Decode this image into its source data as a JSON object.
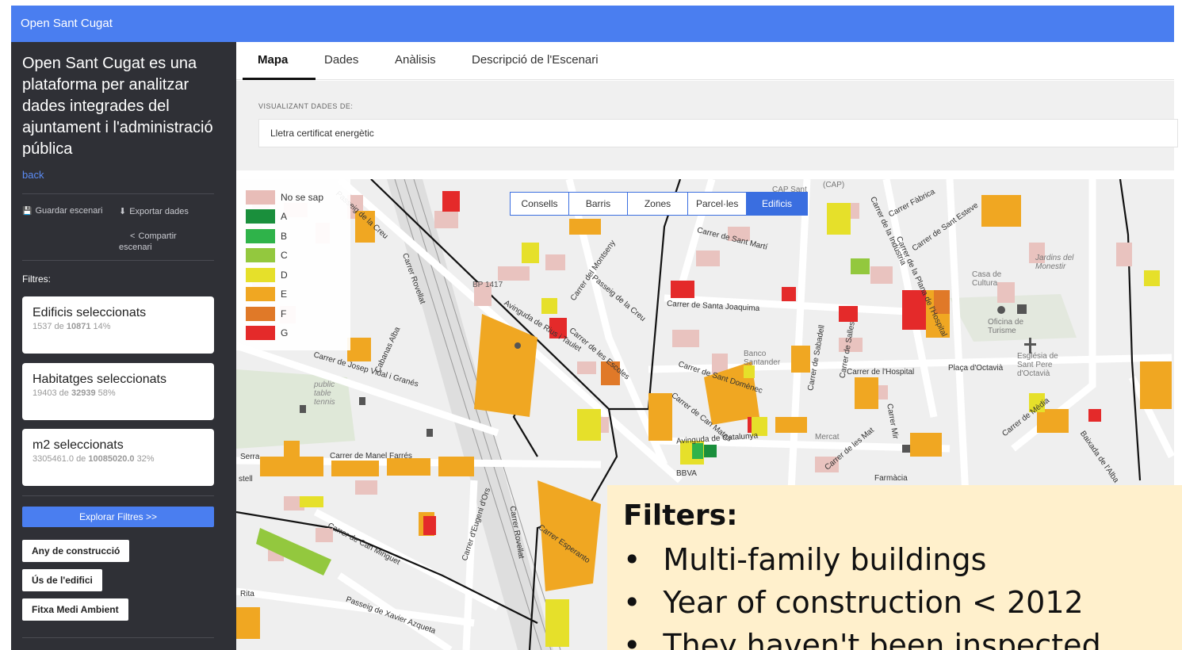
{
  "app_title": "Open Sant Cugat",
  "sidebar": {
    "description": "Open Sant Cugat es una plataforma per analitzar dades integrades del ajuntament i l'administració pública",
    "back": "back",
    "save_label": "Guardar escenari",
    "export_label": "Exportar dades",
    "share_label_1": "Compartir",
    "share_label_2": "escenari",
    "filters_heading": "Filtres:",
    "cards": [
      {
        "title": "Edificis seleccionats",
        "selected": "1537",
        "de": "de",
        "total": "10871",
        "pct": "14%"
      },
      {
        "title": "Habitatges seleccionats",
        "selected": "19403",
        "de": "de",
        "total": "32939",
        "pct": "58%"
      },
      {
        "title": "m2 seleccionats",
        "selected": "3305461.0",
        "de": "de",
        "total": "10085020.0",
        "pct": "32%"
      }
    ],
    "explore_button": "Explorar Filtres >>",
    "chips": [
      "Any de construcció",
      "Ús de l'edifici",
      "Fitxa Medi Ambient"
    ]
  },
  "tabs": [
    "Mapa",
    "Dades",
    "Anàlisis",
    "Descripció de l'Escenari"
  ],
  "active_tab": "Mapa",
  "viz_label": "VISUALIZANT DADES DE:",
  "viz_value": "Lletra certificat energètic",
  "layer_tabs": [
    "Consells",
    "Barris",
    "Zones",
    "Parcel·les",
    "Edificis"
  ],
  "active_layer": "Edificis",
  "legend": [
    {
      "label": "No se sap",
      "color": "#e8bdb8"
    },
    {
      "label": "A",
      "color": "#1a8f3c"
    },
    {
      "label": "B",
      "color": "#2fb34a"
    },
    {
      "label": "C",
      "color": "#93c83e"
    },
    {
      "label": "D",
      "color": "#e6e02a"
    },
    {
      "label": "E",
      "color": "#f0a722"
    },
    {
      "label": "F",
      "color": "#e07928"
    },
    {
      "label": "G",
      "color": "#e42a2a"
    }
  ],
  "streets": [
    "Passeig de la Creu",
    "Carrer de Sant Martí",
    "Carrer Rovellat",
    "Carrer del Montseny",
    "Passeig de la Creu",
    "Avinguda de Rius i Taulet",
    "Carrer de les Escoles",
    "Carrer de Santa Joaquima",
    "Carrer de Josep Vidal i Granés",
    "Cabanas Alba",
    "Carrer de Sant Domènec",
    "Carrer de Can Matas",
    "Avinguda de Catalunya",
    "Carrer de Manel Farrés",
    "Carrer de Can Minguet",
    "Carrer d'Eugeni d'Ors",
    "Carrer Rovellat",
    "Carrer Esperanto",
    "Passeig de Xavier Azqueta",
    "Carrer de l'Hospital",
    "Plaça d'Octavià",
    "Carrer de Sabadell",
    "Carrer de Salles",
    "Carrer de la Indústria",
    "Carrer de la Plana de l'Hospital",
    "Carrer de Sant Esteve",
    "Carrer Fàbrica",
    "Carrer de Mèdia",
    "Baixada de l'Alba",
    "Carrer de les Mat",
    "Carrer Mir",
    "Farmàcia",
    "BBVA",
    "Jardins del Monestir",
    "Oficina de Turisme",
    "Església de Sant Pere d'Octavià",
    "Casa de Cultura",
    "CAP Sant",
    "(CAP)",
    "Mercat",
    "Banco Santander",
    "BP 1417",
    "Rita",
    "Serra",
    "stell",
    "public table tennis"
  ],
  "callout": {
    "title": "Filters:",
    "items": [
      "Multi-family buildings",
      "Year of construction < 2012",
      "They haven't been inspected"
    ]
  }
}
